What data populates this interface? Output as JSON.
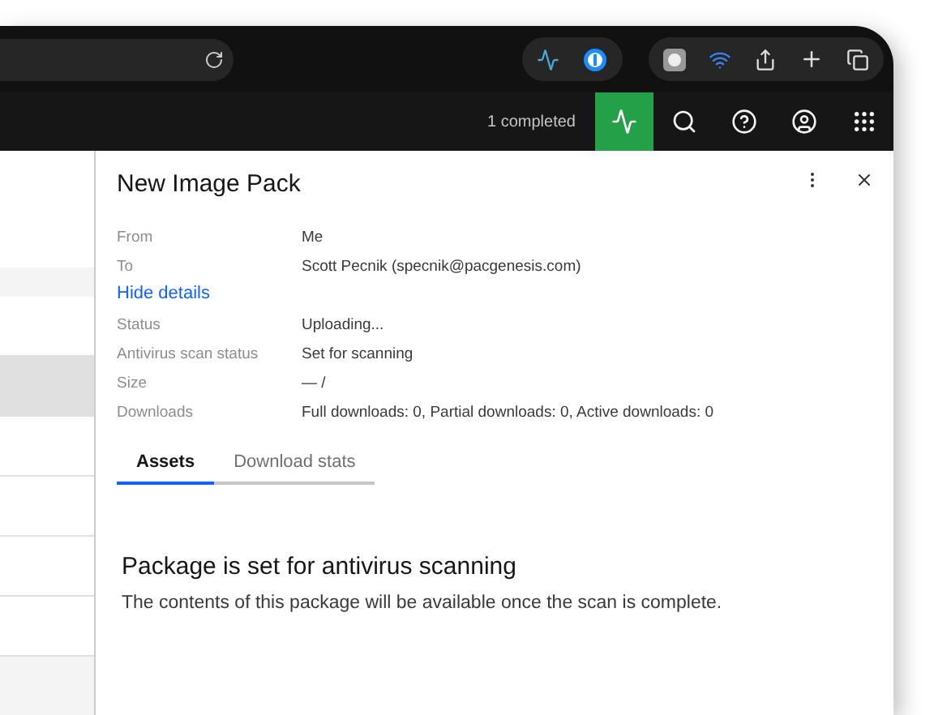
{
  "app_header": {
    "notification": "1 completed"
  },
  "list_rows": [
    {
      "selected": false
    },
    {
      "selected": true
    },
    {
      "selected": false
    },
    {
      "selected": false
    },
    {
      "selected": false
    },
    {
      "selected": false
    }
  ],
  "panel": {
    "title": "New Image Pack",
    "details": [
      {
        "label": "From",
        "value": "Me"
      },
      {
        "label": "To",
        "value": "Scott Pecnik (specnik@pacgenesis.com)"
      }
    ],
    "toggle_link": "Hide details",
    "more_details": [
      {
        "label": "Status",
        "value": "Uploading..."
      },
      {
        "label": "Antivirus scan status",
        "value": "Set for scanning"
      },
      {
        "label": "Size",
        "value": "— /"
      },
      {
        "label": "Downloads",
        "value": "Full downloads: 0, Partial downloads: 0, Active downloads: 0"
      }
    ],
    "tabs": [
      {
        "label": "Assets",
        "selected": true
      },
      {
        "label": "Download stats",
        "selected": false
      }
    ],
    "message_title": "Package is set for antivirus scanning",
    "message_body": "The contents of this package will be available once the scan is complete."
  }
}
